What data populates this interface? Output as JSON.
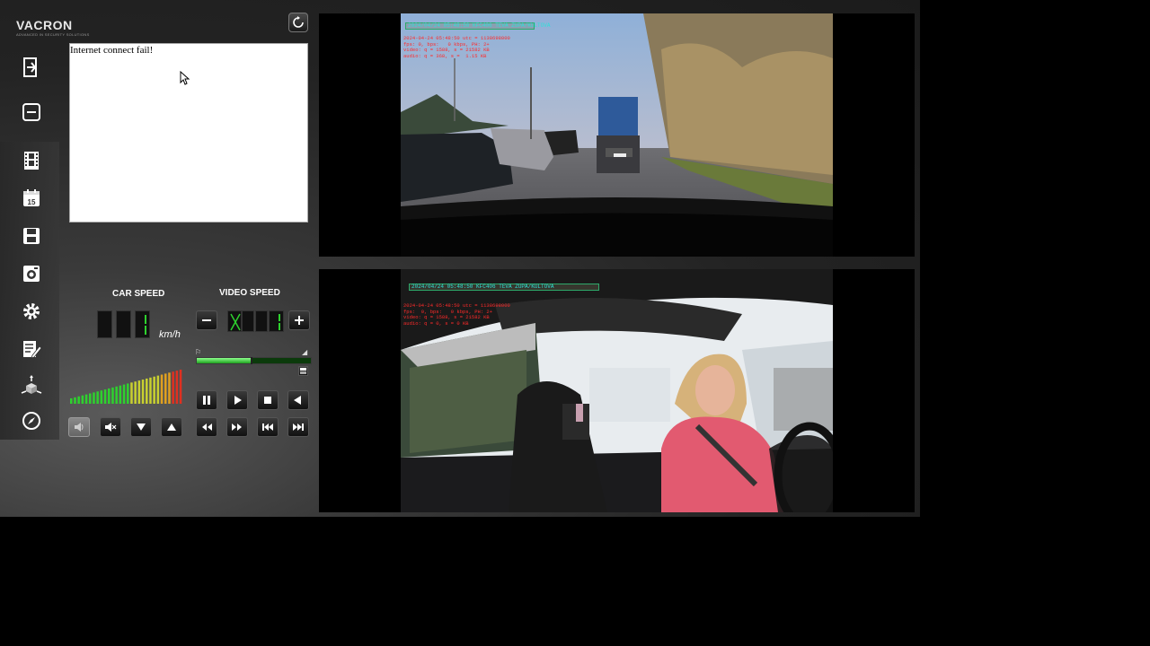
{
  "app": {
    "brand": "VACRON",
    "tagline": "ADVANCED IN SECURITY SOLUTIONS"
  },
  "message_panel": {
    "text": "Internet connect fail!"
  },
  "sidebar": {
    "items": [
      {
        "name": "exit-icon"
      },
      {
        "name": "minimize-icon"
      },
      {
        "name": "film-icon"
      },
      {
        "name": "calendar-icon"
      },
      {
        "name": "save-icon"
      },
      {
        "name": "snapshot-icon"
      },
      {
        "name": "settings-gear-icon"
      },
      {
        "name": "edit-notes-icon"
      },
      {
        "name": "g-sensor-axis-icon"
      },
      {
        "name": "compass-icon"
      }
    ]
  },
  "car_speed": {
    "label": "CAR SPEED",
    "unit": "km/h",
    "digits": [
      "8",
      "8",
      "1"
    ]
  },
  "video_speed": {
    "label": "VIDEO SPEED",
    "minus_label": "−",
    "plus_label": "+",
    "digits": [
      "X",
      "8",
      "8",
      "1"
    ]
  },
  "playback": {
    "progress": 0.48
  },
  "volume": {
    "level": 1.0,
    "bar_count": 30
  },
  "videos": {
    "front": {
      "header": "2024/04/24 05:48:50  KFC406      TEVA ZUPA/KULTOVA",
      "osd": "2024-04-24 05:48:50 utc = 1138698000\nfps: 0, bps:   0 kbps, PH: 2+\nvideo: q = 1588, s = 21582 KB\naudio: q = 368, s =  1.15 KB"
    },
    "cabin": {
      "header": "2024/04/24 05:48:50  KFC406      TEVA ZUPA/KULTOVA",
      "osd": "2024-04-24 05:48:50 utc = 1138698000\nfps:  0, bps:   0 kbps, PH: 2+\nvideo: q = 1588, s = 21582 KB\naudio: q = 0, s = 0 KB"
    }
  },
  "colors": {
    "accent_green": "#2ed12e",
    "osd_red": "#ff2a2a",
    "overlay_cyan": "#2ee0d8"
  }
}
